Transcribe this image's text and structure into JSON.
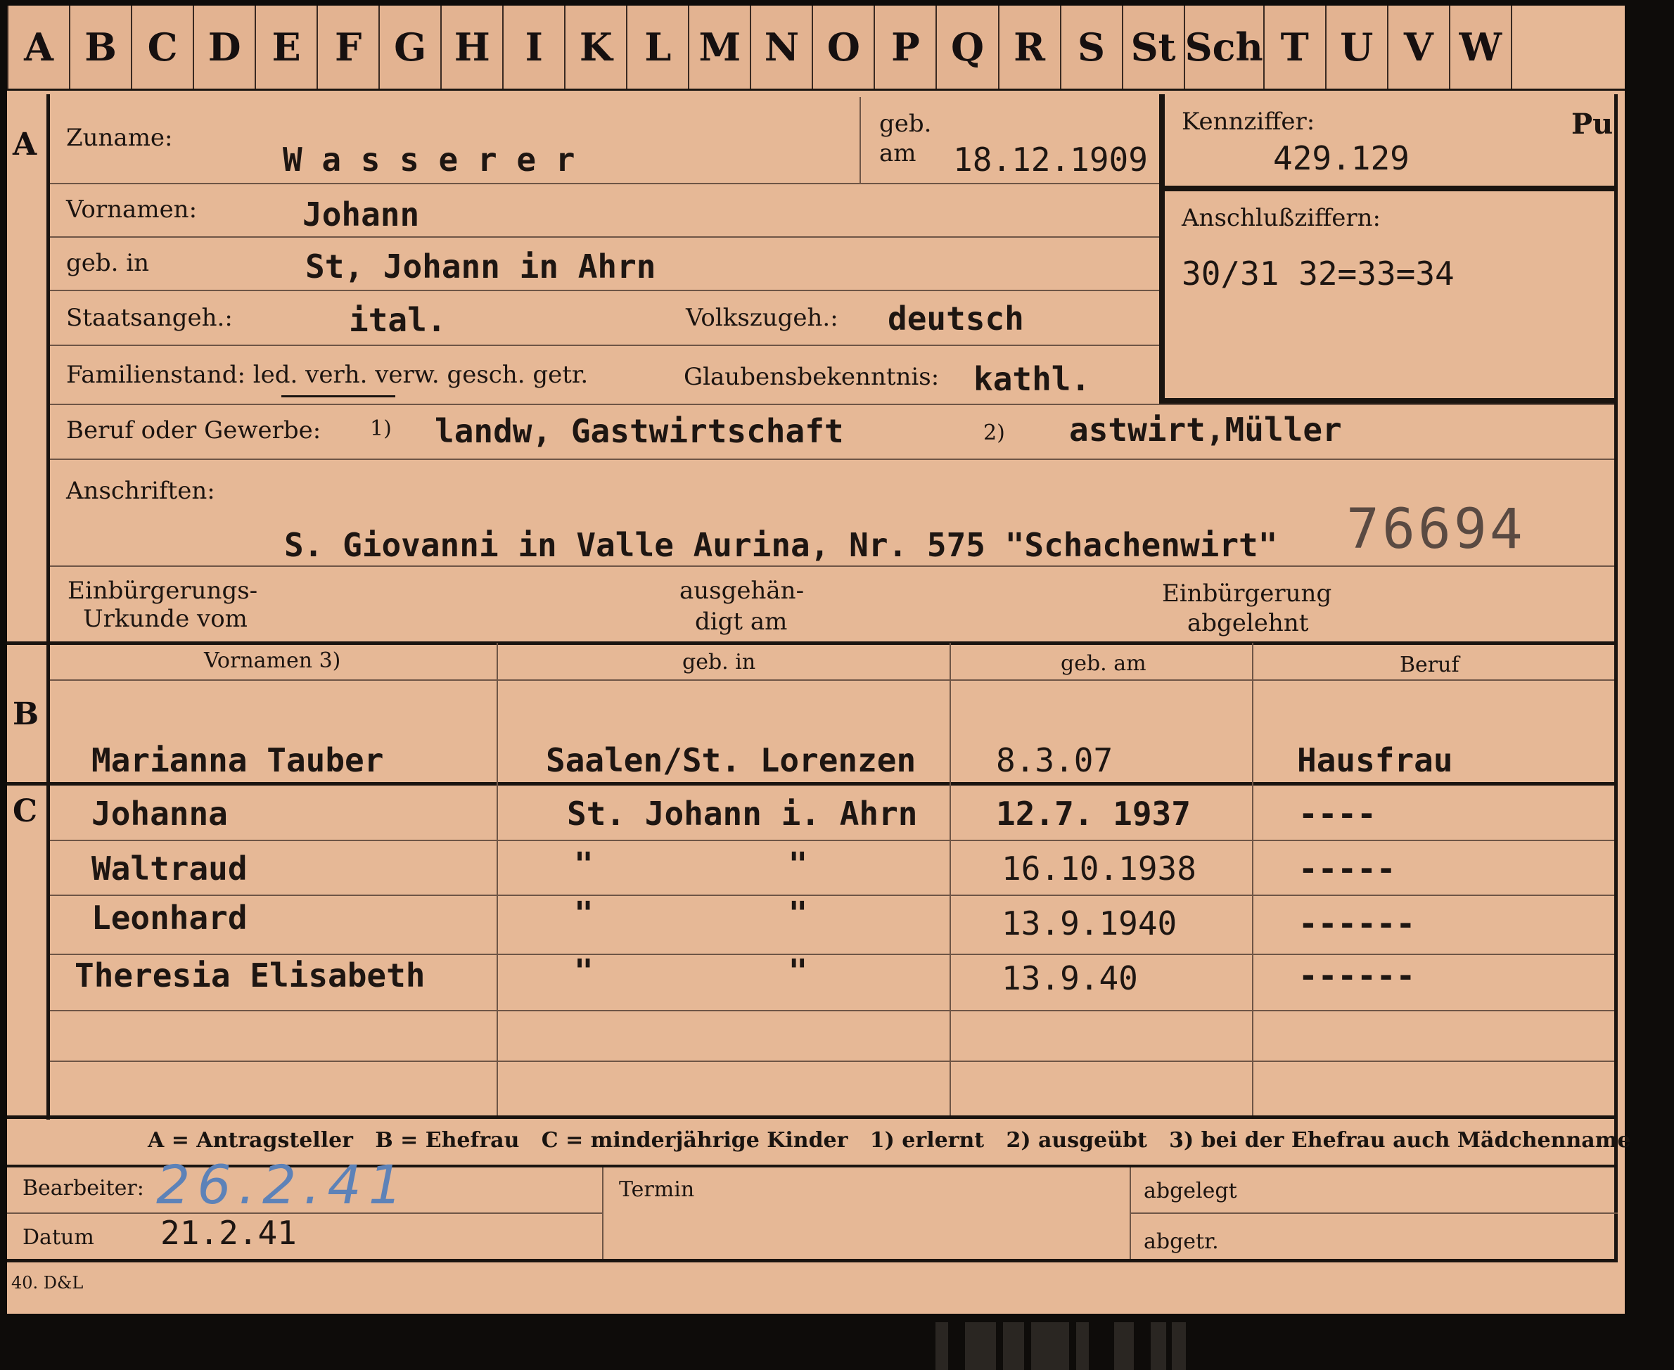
{
  "tabs": [
    "A",
    "B",
    "C",
    "D",
    "E",
    "F",
    "G",
    "H",
    "I",
    "K",
    "L",
    "M",
    "N",
    "O",
    "P",
    "Q",
    "R",
    "S",
    "St",
    "Sch",
    "T",
    "U",
    "V",
    "W"
  ],
  "sections": {
    "a": "A",
    "b": "B",
    "c": "C"
  },
  "applicant": {
    "surname_label": "Zuname:",
    "surname": "W a s s e r e r",
    "born_label_1": "geb.",
    "born_label_2": "am",
    "born_date": "18.12.1909",
    "id_label": "Kennziffer:",
    "id_value": "429.129",
    "id_mark": "Pu",
    "connect_label": "Anschlußziffern:",
    "connect_value": "30/31 32=33=34",
    "firstnames_label": "Vornamen:",
    "firstnames": "Johann",
    "birthplace_label": "geb. in",
    "birthplace": "St, Johann in Ahrn",
    "citizenship_label": "Staatsangeh.:",
    "citizenship": "ital.",
    "ethnicity_label": "Volkszugeh.:",
    "ethnicity": "deutsch",
    "family_label": "Familienstand: led. verh. verw. gesch. getr.",
    "religion_label": "Glaubensbekenntnis:",
    "religion": "kathl.",
    "occupation_label": "Beruf oder Gewerbe:",
    "occ_marker_1": "1)",
    "occupation_1": "landw, Gastwirtschaft",
    "occ_marker_2": "2)",
    "occupation_2": "astwirt,Müller",
    "address_label": "Anschriften:",
    "address": "S. Giovanni in Valle Aurina, Nr. 575 \"Schachenwirt\"",
    "stamp_number": "76694",
    "naturalization_1": "Einbürgerungs-",
    "naturalization_2": "Urkunde vom",
    "handed_1": "ausgehän-",
    "handed_2": "digt am",
    "rejected_1": "Einbürgerung",
    "rejected_2": "abgelehnt"
  },
  "family_table": {
    "headers": [
      "Vornamen 3)",
      "geb. in",
      "geb. am",
      "Beruf"
    ],
    "spouse": [
      "Marianna Tauber",
      "Saalen/St. Lorenzen",
      "8.3.07",
      "Hausfrau"
    ],
    "children": [
      [
        "Johanna",
        "St. Johann i. Ahrn",
        "12.7. 1937",
        "----"
      ],
      [
        "Waltraud",
        "\"          \"",
        "16.10.1938",
        "-----"
      ],
      [
        "Leonhard",
        "\"          \"",
        "13.9.1940",
        "------"
      ],
      [
        "Theresia Elisabeth",
        "\"          \"",
        "13.9.40",
        "------"
      ]
    ]
  },
  "legend": "A = Antragsteller   B = Ehefrau   C = minderjährige Kinder   1) erlernt   2) ausgeübt   3) bei der Ehefrau auch Mädchenname",
  "footer": {
    "processor_label": "Bearbeiter:",
    "processor_handwriting": "26.2.41",
    "date_label": "Datum",
    "date_value": "21.2.41",
    "deadline_label": "Termin",
    "filed_label": "abgelegt",
    "sent_label": "abgetr.",
    "print_mark": "40. D&L"
  },
  "colors": {
    "card": "#e6b896",
    "ink": "#1c1410",
    "handwriting": "#5d82b8"
  }
}
